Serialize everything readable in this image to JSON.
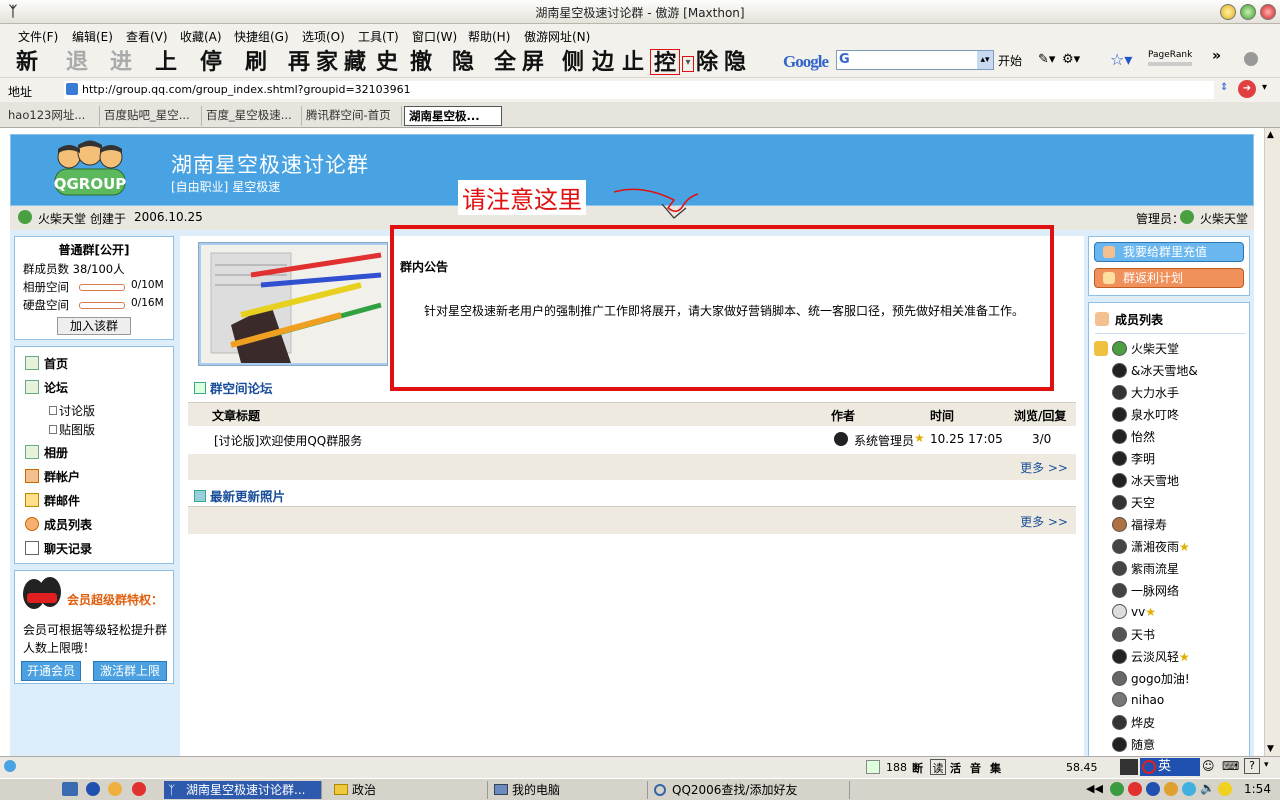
{
  "window": {
    "title": "湖南星空极速讨论群 - 傲游 [Maxthon]"
  },
  "menu": [
    "文件(F)",
    "编辑(E)",
    "查看(V)",
    "收藏(A)",
    "快捷组(G)",
    "选项(O)",
    "工具(T)",
    "窗口(W)",
    "帮助(H)",
    "傲游网址(N)"
  ],
  "toolbar": {
    "buttons": [
      "新",
      "退",
      "进",
      "上",
      "停",
      "刷",
      "再",
      "家",
      "藏",
      "史",
      "撤",
      "隐",
      "全",
      "屏",
      "侧",
      "边",
      "止",
      "控",
      "除",
      "隐"
    ],
    "google_label": "Google",
    "google_search_value": "G",
    "start_label": "开始",
    "pagerank_label": "PageRank"
  },
  "address": {
    "label": "地址",
    "url": "http://group.qq.com/group_index.shtml?groupid=32103961"
  },
  "tabs": [
    {
      "label": "hao123网址..."
    },
    {
      "label": "百度贴吧_星空..."
    },
    {
      "label": "百度_星空极速..."
    },
    {
      "label": "腾讯群空间-首页"
    },
    {
      "label": "湖南星空极..."
    }
  ],
  "page": {
    "group_title": "湖南星空极速讨论群",
    "group_category": "[自由职业]",
    "group_tag": "星空极速",
    "creator": "火柴天堂",
    "created_text": "创建于",
    "created_date": "2006.10.25",
    "admin_label": "管理员：",
    "admin_name": "火柴天堂",
    "annotation": "请注意这里",
    "group_type": "普通群[公开]",
    "members_label": "群成员数",
    "members_value": "38/100人",
    "album_label": "相册空间",
    "album_value": "0/10M",
    "disk_label": "硬盘空间",
    "disk_value": "0/16M",
    "join_button": "加入该群",
    "nav": {
      "home": "首页",
      "forum": "论坛",
      "forum_sub1": "讨论版",
      "forum_sub2": "贴图版",
      "album": "相册",
      "account": "群帐户",
      "mail": "群邮件",
      "members": "成员列表",
      "chat": "聊天记录"
    },
    "vip_title": "会员超级群特权：",
    "vip_text": "会员可根据等级轻松提升群人数上限哦！",
    "vip_btn1": "开通会员",
    "vip_btn2": "激活群上限",
    "notice_title": "群内公告",
    "notice_text": "针对星空极速新老用户的强制推广工作即将展开，请大家做好营销脚本、统一客服口径，预先做好相关准备工作。",
    "forum_title": "群空间论坛",
    "forum_cols": {
      "title": "文章标题",
      "author": "作者",
      "time": "时间",
      "views": "浏览/回复"
    },
    "forum_rows": [
      {
        "title": "[讨论版]欢迎使用QQ群服务",
        "author": "系统管理员",
        "time": "10.25 17:05",
        "views": "3/0"
      }
    ],
    "more1": "更多 >>",
    "photos_title": "最新更新照片",
    "more2": "更多 >>",
    "recharge_btn": "我要给群里充值",
    "rebate_btn": "群返利计划",
    "member_list_title": "成员列表",
    "members": [
      {
        "name": "火柴天堂",
        "star": false
      },
      {
        "name": "&冰天雪地&",
        "star": false
      },
      {
        "name": "大力水手",
        "star": false
      },
      {
        "name": "泉水叮咚",
        "star": false
      },
      {
        "name": "怡然",
        "star": false
      },
      {
        "name": "李明",
        "star": false
      },
      {
        "name": "冰天雪地",
        "star": false
      },
      {
        "name": "天空",
        "star": false
      },
      {
        "name": "福禄寿",
        "star": false
      },
      {
        "name": "潇湘夜雨",
        "star": true
      },
      {
        "name": "紫雨流星",
        "star": false
      },
      {
        "name": "一脉网络",
        "star": false
      },
      {
        "name": "vv",
        "star": true
      },
      {
        "name": "天书",
        "star": false
      },
      {
        "name": "云淡风轻",
        "star": true
      },
      {
        "name": "gogo加油!",
        "star": false
      },
      {
        "name": "nihao",
        "star": false
      },
      {
        "name": "烨皮",
        "star": false
      },
      {
        "name": "随意",
        "star": false
      }
    ]
  },
  "statusbar": {
    "count": "188",
    "read_label": "读",
    "activity_label": "活",
    "zoom": "58.45",
    "ime_label": "英"
  },
  "taskbar": {
    "tasks": [
      "湖南星空极速讨论群...",
      "政治",
      "我的电脑",
      "QQ2006查找/添加好友"
    ],
    "clock": "1:54"
  },
  "colors": {
    "banner": "#49a3e2",
    "annotation_red": "#e01010",
    "page_bg": "#ddeefa"
  }
}
